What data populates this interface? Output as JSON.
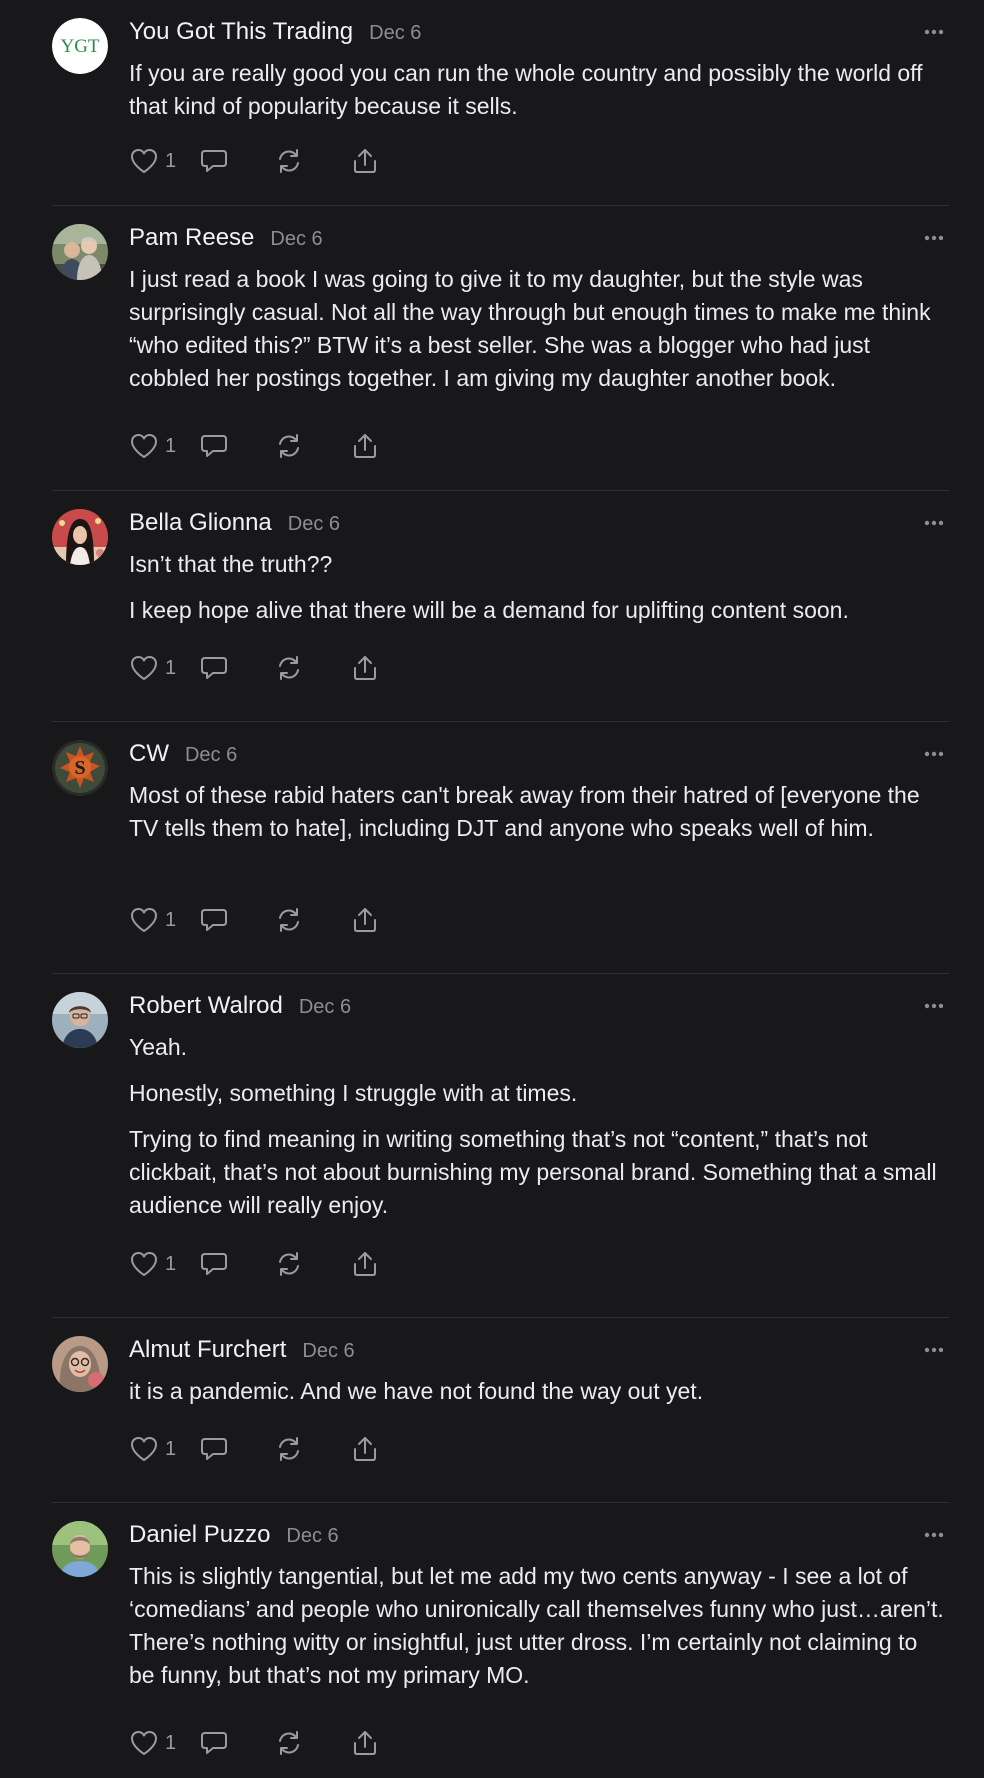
{
  "comments": [
    {
      "author": "You Got This Trading",
      "date": "Dec 6",
      "avatar": "ygt-logo",
      "paragraphs": [
        "If you are really good you can run the whole country and possibly the world off that kind of popularity because it sells."
      ],
      "likes": "1"
    },
    {
      "author": "Pam Reese",
      "date": "Dec 6",
      "avatar": "photo",
      "paragraphs": [
        "I just read a book I was going to give it to my daughter, but the style was surprisingly casual. Not all the way through but enough times to make me think “who edited this?” BTW it’s a best seller. She was a blogger who had just cobbled her postings together. I am giving my daughter another book."
      ],
      "likes": "1"
    },
    {
      "author": "Bella Glionna",
      "date": "Dec 6",
      "avatar": "photo",
      "paragraphs": [
        "Isn’t that the truth??",
        "I keep hope alive that there will be a demand for uplifting content soon."
      ],
      "likes": "1"
    },
    {
      "author": "CW",
      "date": "Dec 6",
      "avatar": "s-emblem",
      "paragraphs": [
        "Most of these rabid haters can't break away from their hatred of [everyone the TV tells them to hate], including DJT and anyone who speaks well of him."
      ],
      "likes": "1"
    },
    {
      "author": "Robert Walrod",
      "date": "Dec 6",
      "avatar": "photo",
      "paragraphs": [
        "Yeah.",
        "Honestly, something I struggle with at times.",
        "Trying to find meaning in writing something that’s not “content,” that’s not clickbait, that’s not about burnishing my personal brand. Something that a small audience will really enjoy."
      ],
      "likes": "1"
    },
    {
      "author": "Almut Furchert",
      "date": "Dec 6",
      "avatar": "photo",
      "paragraphs": [
        "it is a pandemic. And we have not found the way out yet."
      ],
      "likes": "1"
    },
    {
      "author": "Daniel Puzzo",
      "date": "Dec 6",
      "avatar": "photo",
      "paragraphs": [
        "This is slightly tangential, but let me add my two cents anyway - I see a lot of ‘comedians’ and people who unironically call themselves funny who just…aren’t. There’s nothing witty or insightful, just utter dross. I’m certainly not claiming to be funny, but that’s not my primary MO."
      ],
      "likes": "1"
    }
  ],
  "icons": {
    "like": "heart-icon",
    "reply": "speech-bubble-icon",
    "restack": "restack-icon",
    "share": "share-icon",
    "more": "ellipsis-icon"
  },
  "logos": {
    "ygt": "YGT",
    "cw_emblem": "S"
  },
  "colors": {
    "background": "#18181b",
    "text": "#ececee",
    "muted": "#8d8d92",
    "divider": "#2f2f33"
  }
}
